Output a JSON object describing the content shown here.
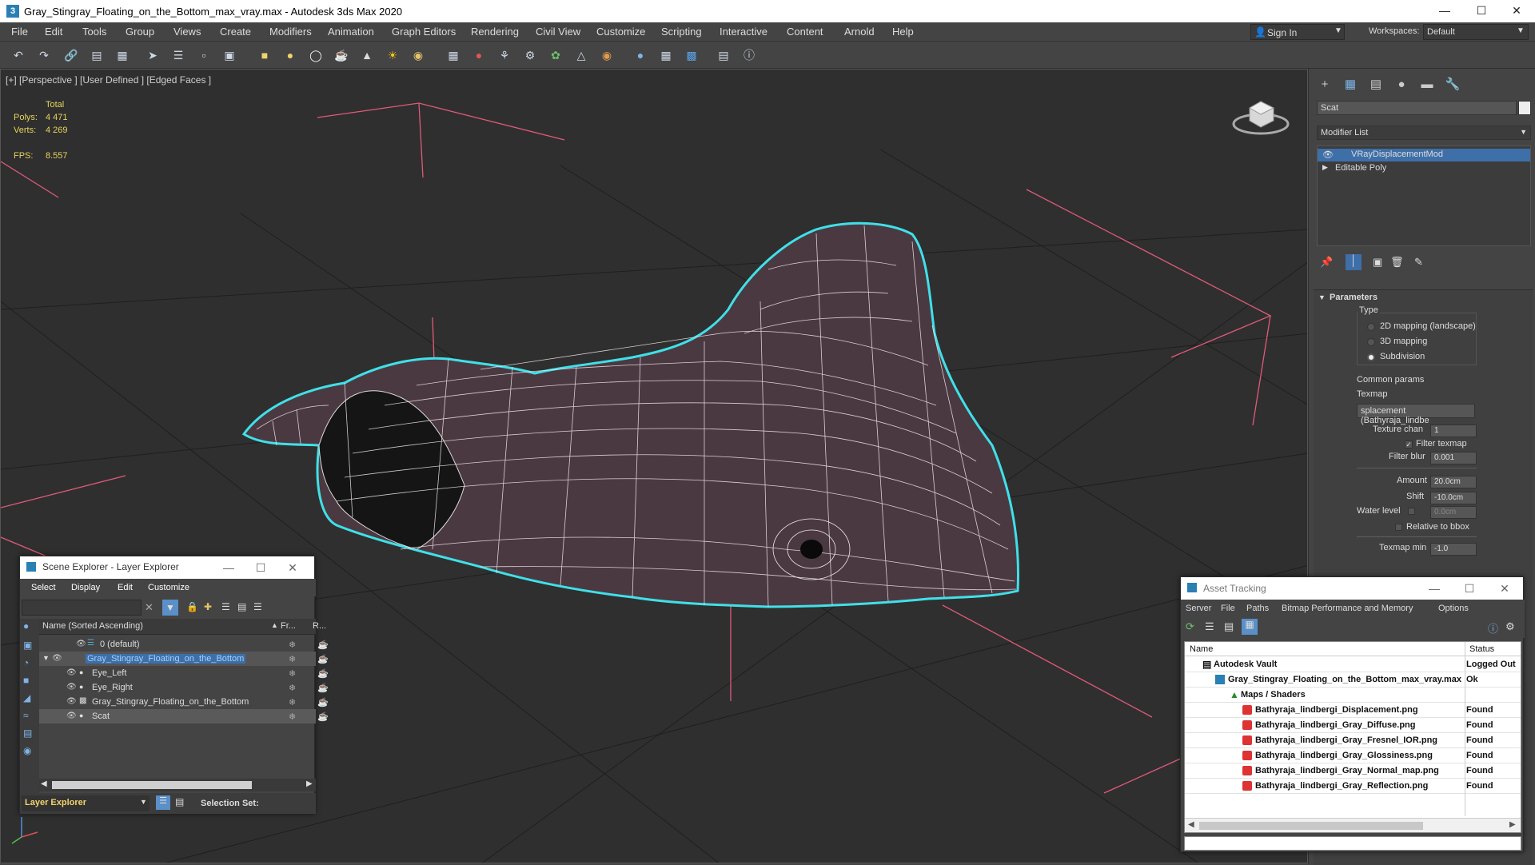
{
  "app": {
    "title": "Gray_Stingray_Floating_on_the_Bottom_max_vray.max - Autodesk 3ds Max 2020",
    "icon": "3"
  },
  "menus": [
    "File",
    "Edit",
    "Tools",
    "Group",
    "Views",
    "Create",
    "Modifiers",
    "Animation",
    "Graph Editors",
    "Rendering",
    "Civil View",
    "Customize",
    "Scripting",
    "Interactive",
    "Content",
    "Arnold",
    "Help"
  ],
  "signin": "Sign In",
  "workspaces": {
    "label": "Workspaces:",
    "value": "Default"
  },
  "viewport": {
    "label": "[+] [Perspective ] [User Defined ] [Edged Faces ]",
    "stats": {
      "total": "Total",
      "polys_label": "Polys:",
      "polys": "4 471",
      "verts_label": "Verts:",
      "verts": "4 269",
      "fps_label": "FPS:",
      "fps": "8.557"
    }
  },
  "command_panel": {
    "name_field": "Scat",
    "modifier_list": "Modifier List",
    "stack": [
      "VRayDisplacementMod",
      "Editable Poly"
    ],
    "parameters": "Parameters",
    "type_label": "Type",
    "type_options": [
      "2D mapping (landscape)",
      "3D mapping",
      "Subdivision"
    ],
    "common_params": "Common params",
    "texmap_label": "Texmap",
    "texmap_value": "splacement (Bathyraja_lindbe",
    "texture_chan_label": "Texture chan",
    "texture_chan": "1",
    "filter_texmap": "Filter texmap",
    "filter_blur_label": "Filter blur",
    "filter_blur": "0.001",
    "amount_label": "Amount",
    "amount": "20.0cm",
    "shift_label": "Shift",
    "shift": "-10.0cm",
    "water_label": "Water level",
    "water": "0.0cm",
    "relative_bbox": "Relative to bbox",
    "texmap_min_label": "Texmap min",
    "texmap_min": "-1.0"
  },
  "scene_explorer": {
    "title": "Scene Explorer - Layer Explorer",
    "menus": [
      "Select",
      "Display",
      "Edit",
      "Customize"
    ],
    "col_name": "Name (Sorted Ascending)",
    "col_fr": "Fr...",
    "col_r": "R...",
    "rows": [
      "0 (default)",
      "Gray_Stingray_Floating_on_the_Bottom",
      "Eye_Left",
      "Eye_Right",
      "Gray_Stingray_Floating_on_the_Bottom",
      "Scat"
    ],
    "footer_mode": "Layer Explorer",
    "selection_set": "Selection Set:"
  },
  "asset_tracking": {
    "title": "Asset Tracking",
    "menus": [
      "Server",
      "File",
      "Paths",
      "Bitmap Performance and Memory",
      "Options"
    ],
    "col_name": "Name",
    "col_status": "Status",
    "rows": [
      {
        "name": "Autodesk Vault",
        "status": "Logged Out ..."
      },
      {
        "name": "Gray_Stingray_Floating_on_the_Bottom_max_vray.max",
        "status": "Ok"
      },
      {
        "name": "Maps / Shaders",
        "status": ""
      },
      {
        "name": "Bathyraja_lindbergi_Displacement.png",
        "status": "Found"
      },
      {
        "name": "Bathyraja_lindbergi_Gray_Diffuse.png",
        "status": "Found"
      },
      {
        "name": "Bathyraja_lindbergi_Gray_Fresnel_IOR.png",
        "status": "Found"
      },
      {
        "name": "Bathyraja_lindbergi_Gray_Glossiness.png",
        "status": "Found"
      },
      {
        "name": "Bathyraja_lindbergi_Gray_Normal_map.png",
        "status": "Found"
      },
      {
        "name": "Bathyraja_lindbergi_Gray_Reflection.png",
        "status": "Found"
      }
    ]
  },
  "colors": {
    "selection": "#3e6fa8",
    "cyan_outline": "#40e0e8",
    "wire": "#ffffff",
    "grid": "#e05a7a"
  }
}
